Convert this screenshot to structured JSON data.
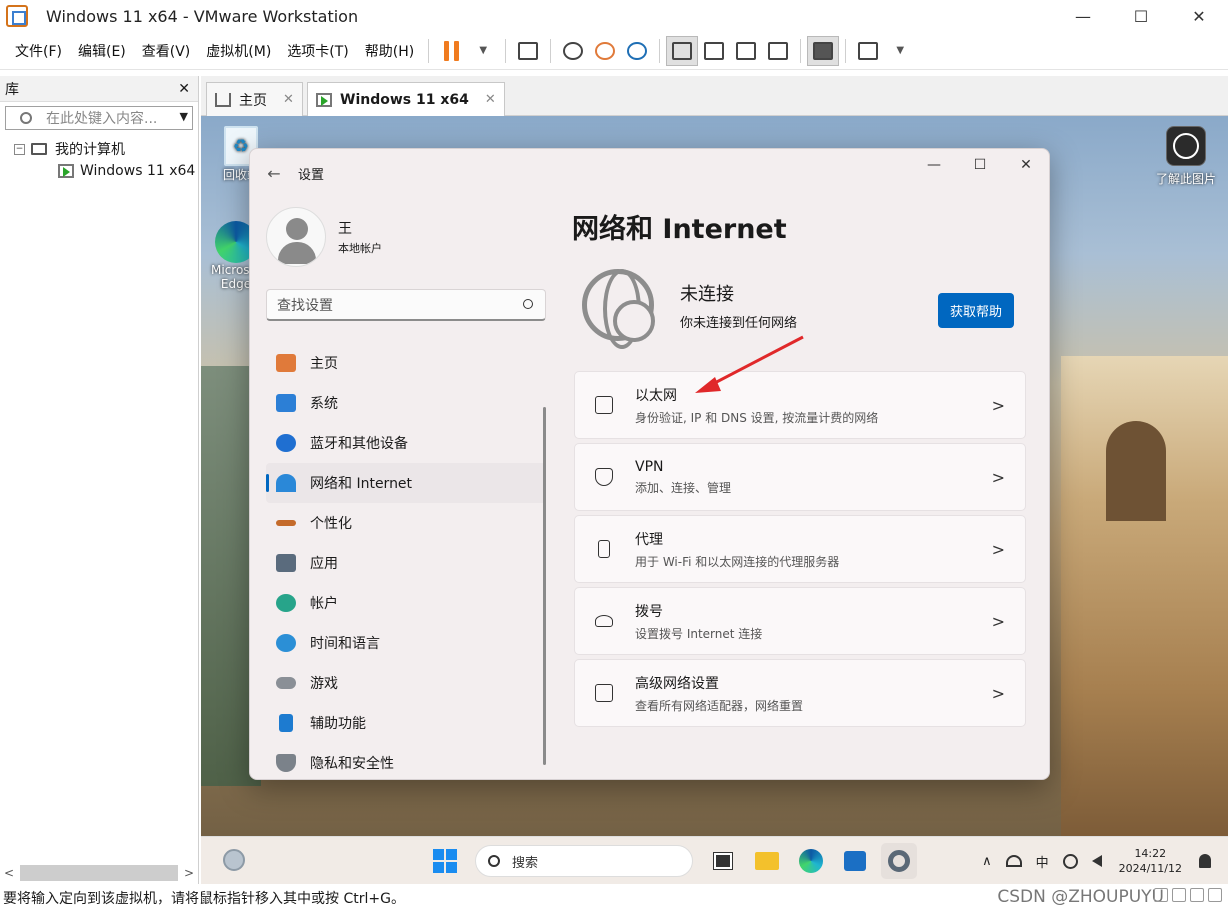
{
  "window": {
    "title": "Windows 11 x64 - VMware Workstation",
    "min": "—",
    "max": "☐",
    "close": "✕"
  },
  "menu": [
    "文件(F)",
    "编辑(E)",
    "查看(V)",
    "虚拟机(M)",
    "选项卡(T)",
    "帮助(H)"
  ],
  "toolbar": {
    "pause_color": "#f07b1f"
  },
  "library": {
    "title": "库",
    "close": "✕",
    "search_placeholder": "在此处键入内容...",
    "tree": {
      "root": "我的计算机",
      "expand": "−",
      "vm": "Windows 11 x64"
    },
    "scroll_left": "<",
    "scroll_right": ">"
  },
  "tabs": [
    {
      "label": "主页",
      "close": "✕"
    },
    {
      "label": "Windows 11 x64",
      "close": "✕"
    }
  ],
  "desktop": {
    "recycle": "回收站",
    "edge": "Microsoft Edge",
    "learn": "了解此图片"
  },
  "settings": {
    "app_title": "设置",
    "back": "←",
    "min": "—",
    "max": "☐",
    "close": "✕",
    "user": {
      "name": "王",
      "type": "本地帐户"
    },
    "search_placeholder": "查找设置",
    "nav": [
      {
        "label": "主页",
        "color": "#e07a3a"
      },
      {
        "label": "系统",
        "color": "#2c7fd6"
      },
      {
        "label": "蓝牙和其他设备",
        "color": "#1f6fd1"
      },
      {
        "label": "网络和 Internet",
        "color": "#2a88d8"
      },
      {
        "label": "个性化",
        "color": "#c46a2a"
      },
      {
        "label": "应用",
        "color": "#5a6b7d"
      },
      {
        "label": "帐户",
        "color": "#27a48a"
      },
      {
        "label": "时间和语言",
        "color": "#2b8fd6"
      },
      {
        "label": "游戏",
        "color": "#8a8f96"
      },
      {
        "label": "辅助功能",
        "color": "#1d7bd0"
      },
      {
        "label": "隐私和安全性",
        "color": "#7b828a"
      }
    ],
    "page_title": "网络和 Internet",
    "status_title": "未连接",
    "status_desc": "你未连接到任何网络",
    "help_button": "获取帮助",
    "cards": [
      {
        "title": "以太网",
        "desc": "身份验证, IP 和 DNS 设置, 按流量计费的网络"
      },
      {
        "title": "VPN",
        "desc": "添加、连接、管理"
      },
      {
        "title": "代理",
        "desc": "用于 Wi-Fi 和以太网连接的代理服务器"
      },
      {
        "title": "拨号",
        "desc": "设置拨号 Internet 连接"
      },
      {
        "title": "高级网络设置",
        "desc": "查看所有网络适配器，网络重置"
      }
    ],
    "chevron": ">"
  },
  "taskbar": {
    "search": "搜索",
    "tray": {
      "chevron": "∧",
      "ime": "中",
      "time": "14:22",
      "date": "2024/11/12"
    }
  },
  "statusbar": {
    "text": "要将输入定向到该虚拟机，请将鼠标指针移入其中或按 Ctrl+G。"
  },
  "watermark": "CSDN @ZHOUPUYU",
  "accent": "#0067c0"
}
